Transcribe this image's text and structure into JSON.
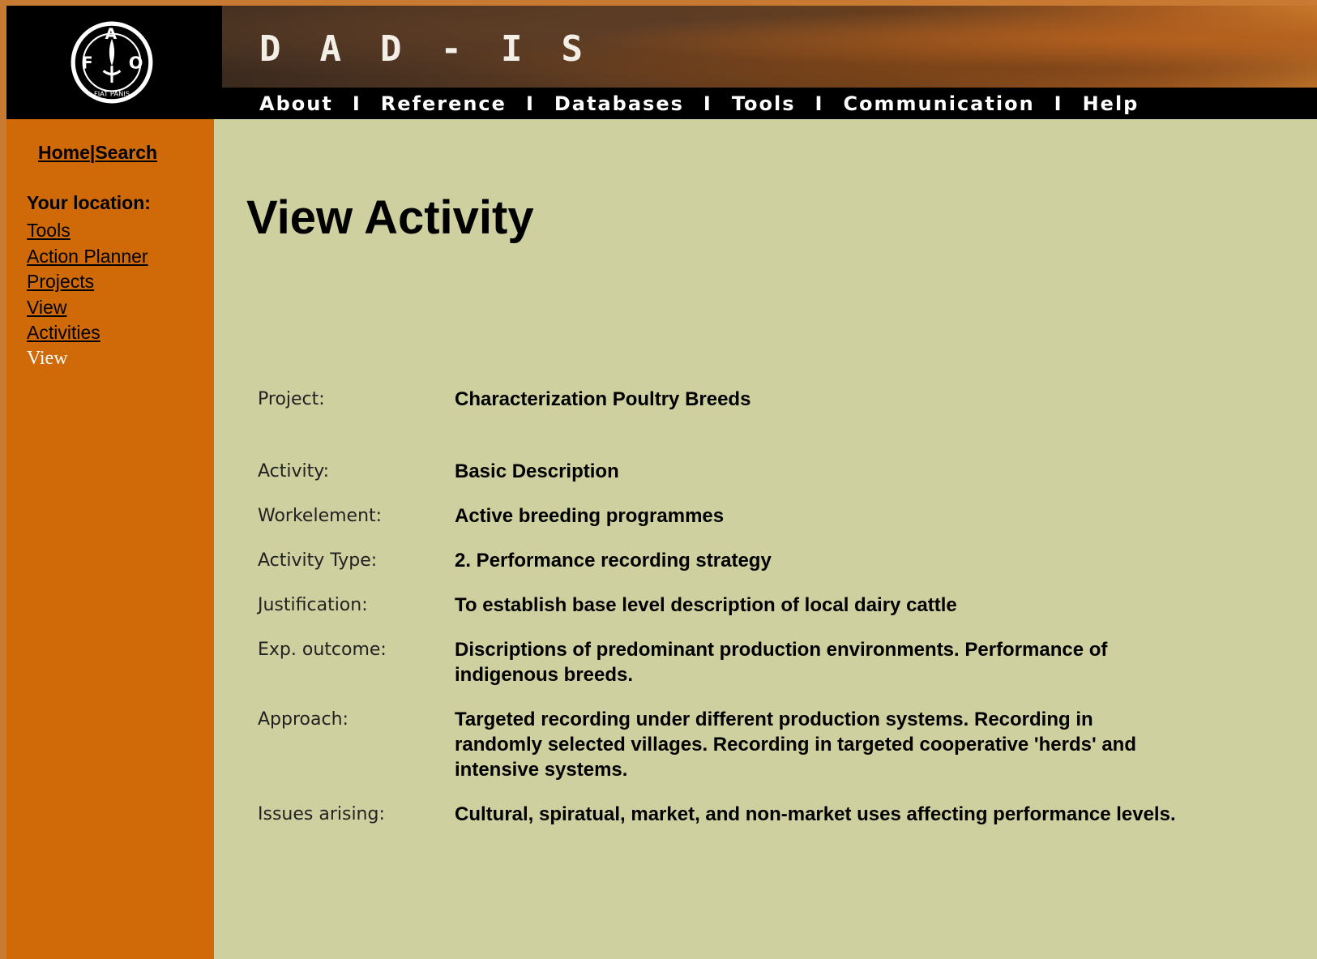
{
  "header": {
    "site_title": "DAD-IS",
    "nav": [
      "About",
      "Reference",
      "Databases",
      "Tools",
      "Communication",
      "Help"
    ],
    "nav_separator": "I",
    "logo_letters": [
      "F",
      "A",
      "O"
    ],
    "logo_motto": "FIAT PANIS"
  },
  "sidebar": {
    "home_label": "Home",
    "search_label": "Search",
    "location_heading": "Your location:",
    "breadcrumb": [
      "Tools",
      "Action Planner",
      "Projects",
      "View",
      "Activities"
    ],
    "current": "View"
  },
  "main": {
    "title": "View Activity",
    "fields": [
      {
        "label": "Project:",
        "value": "Characterization Poultry Breeds"
      },
      {
        "label": "Activity:",
        "value": "Basic Description"
      },
      {
        "label": "Workelement:",
        "value": "Active breeding programmes"
      },
      {
        "label": "Activity Type:",
        "value": "2. Performance recording strategy"
      },
      {
        "label": "Justification:",
        "value": "To establish base level description of local dairy cattle"
      },
      {
        "label": "Exp. outcome:",
        "value": "Discriptions of predominant production environments. Performance of indigenous breeds."
      },
      {
        "label": "Approach:",
        "value": "Targeted recording under different production systems. Recording in randomly selected villages. Recording in targeted cooperative 'herds' and intensive systems."
      },
      {
        "label": "Issues arising:",
        "value": "Cultural, spiratual, market, and non-market uses affecting performance levels."
      }
    ]
  },
  "colors": {
    "sidebar": "#d06a09",
    "content_bg": "#cfd09f",
    "header_bg": "#000000"
  }
}
